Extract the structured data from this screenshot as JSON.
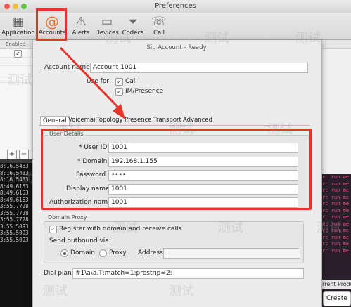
{
  "window": {
    "title": "Preferences"
  },
  "toolbar": {
    "items": [
      {
        "label": "Application",
        "icon": "application-icon"
      },
      {
        "label": "Accounts",
        "icon": "at-sign-icon"
      },
      {
        "label": "Alerts",
        "icon": "warning-icon"
      },
      {
        "label": "Devices",
        "icon": "devices-icon"
      },
      {
        "label": "Codecs",
        "icon": "funnel-icon"
      },
      {
        "label": "Call",
        "icon": "phone-icon"
      }
    ]
  },
  "left_list": {
    "header": "Enabled",
    "add_label": "+",
    "remove_label": "−"
  },
  "terminal": {
    "lines": [
      "8:16.5433",
      "8:16.5433",
      "8:16.5433",
      "8:49.6153",
      "8:49.6153",
      "8:49.6153",
      "3:55.7728",
      "3:55.7728",
      "3:55.7728",
      "3:55.5093",
      "3:55.5093",
      "3:55.5093"
    ]
  },
  "right_bg": {
    "lines": [
      "rc run me",
      "rc run me",
      "rc run me",
      "rc run me",
      "rc run me",
      "rc run me",
      "rc run me",
      "rc run me",
      "rc run me",
      "rc run me",
      "rc run me",
      "rc run me"
    ],
    "footer": "urrent Produ",
    "create_label": "Create"
  },
  "sheet": {
    "title": "Sip Account - Ready",
    "account_name_label": "Account name:",
    "account_name_value": "Account 1001",
    "use_for_label": "Use for:",
    "use_call": "Call",
    "use_im": "IM/Presence",
    "tabs": [
      "General",
      "Voicemail",
      "Topology",
      "Presence",
      "Transport",
      "Advanced"
    ],
    "user_details": {
      "title": "User Details",
      "user_id_label": "* User ID",
      "user_id": "1001",
      "domain_label": "* Domain",
      "domain": "192.168.1.155",
      "password_label": "Password",
      "password": "••••",
      "display_name_label": "Display name",
      "display_name": "1001",
      "auth_name_label": "Authorization name",
      "auth_name": "1001"
    },
    "domain_proxy": {
      "title": "Domain Proxy",
      "register_label": "Register with domain and receive calls",
      "send_outbound_label": "Send outbound via:",
      "opt_domain": "Domain",
      "opt_proxy": "Proxy",
      "address_label": "Address"
    },
    "dial_plan_label": "Dial plan",
    "dial_plan_value": "#1\\a\\a.T;match=1;prestrip=2;"
  },
  "colors": {
    "highlight": "#e8332a",
    "accent_orange": "#e8732a"
  }
}
